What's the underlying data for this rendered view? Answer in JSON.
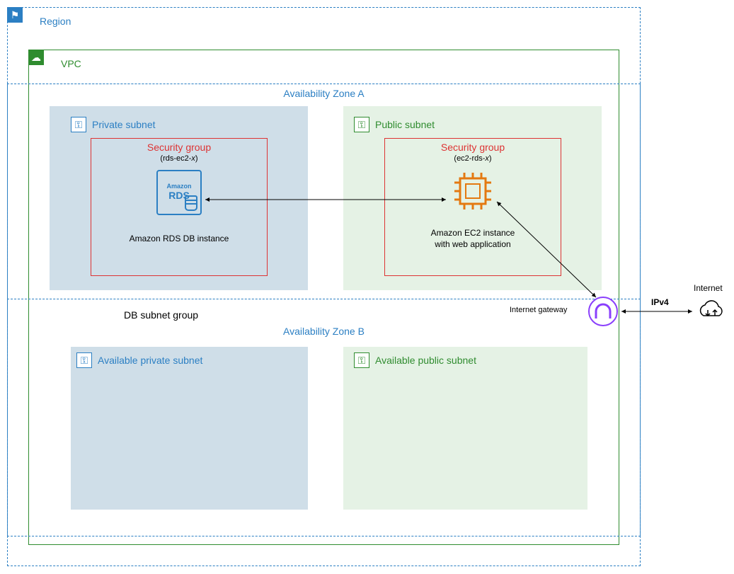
{
  "region": {
    "label": "Region"
  },
  "vpc": {
    "label": "VPC"
  },
  "az_a": {
    "label": "Availability Zone A"
  },
  "az_b": {
    "label": "Availability Zone B"
  },
  "db_subnet_group": {
    "label": "DB subnet group"
  },
  "private_subnet_a": {
    "label": "Private subnet"
  },
  "public_subnet_a": {
    "label": "Public subnet"
  },
  "private_subnet_b": {
    "label": "Available private subnet"
  },
  "public_subnet_b": {
    "label": "Available public subnet"
  },
  "sg_rds": {
    "title": "Security group",
    "name_prefix": "(rds-ec2-",
    "name_suffix": ")",
    "x": "x"
  },
  "sg_ec2": {
    "title": "Security group",
    "name_prefix": "(ec2-rds-",
    "name_suffix": ")",
    "x": "x"
  },
  "rds": {
    "logo_line1": "Amazon",
    "logo_line2": "RDS",
    "caption": "Amazon RDS DB instance"
  },
  "ec2": {
    "caption_line1": "Amazon EC2 instance",
    "caption_line2": "with web application"
  },
  "igw": {
    "label": "Internet gateway"
  },
  "ipv4": {
    "label": "IPv4"
  },
  "internet": {
    "label": "Internet"
  }
}
